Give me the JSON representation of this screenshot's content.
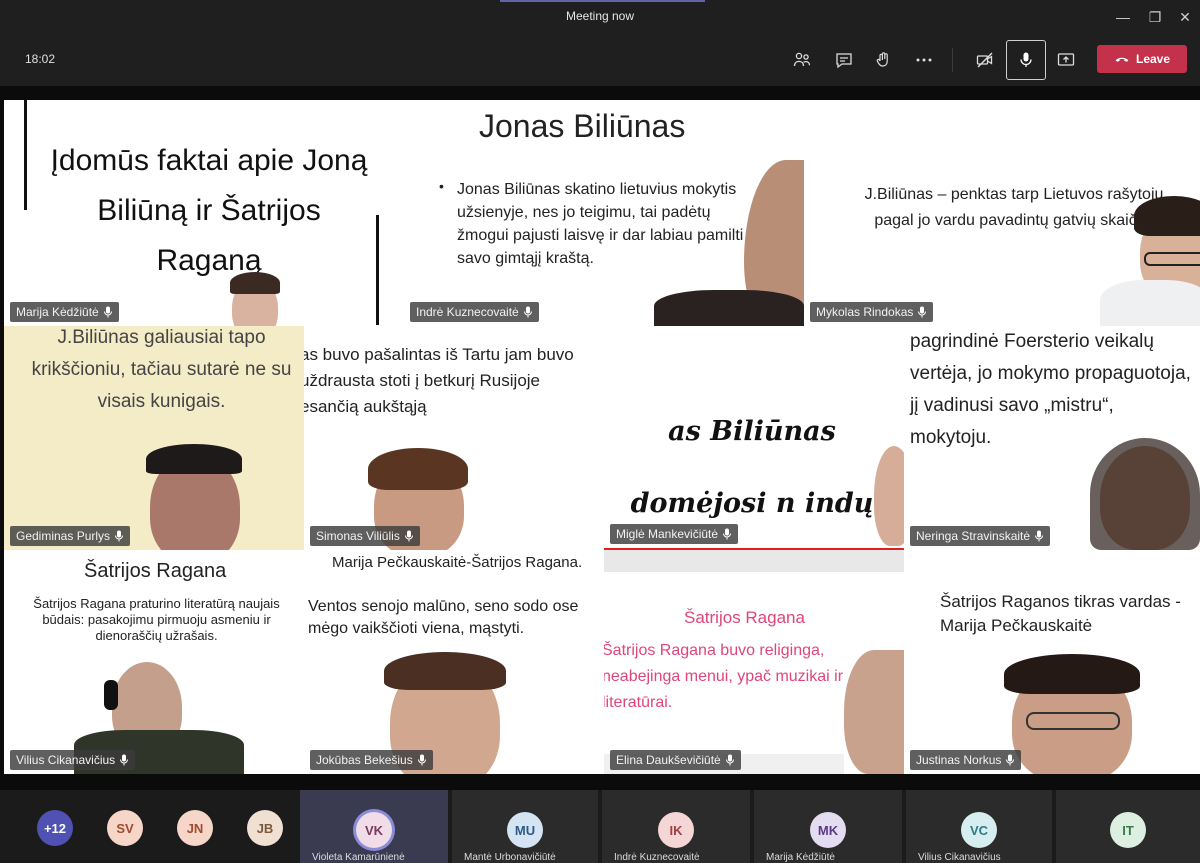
{
  "window": {
    "title": "Meeting now"
  },
  "toolbar": {
    "time": "18:02",
    "leave_label": "Leave"
  },
  "tiles": [
    {
      "name": "Marija Kėdžiūtė",
      "slide": "Įdomūs faktai apie Joną Biliūną ir Šatrijos Raganą"
    },
    {
      "name": "Indrė Kuznecovaitė",
      "slide_title": "Jonas Biliūnas",
      "slide": "Jonas Biliūnas skatino lietuvius mokytis užsienyje, nes jo teigimu, tai padėtų žmogui pajusti laisvę ir dar labiau pamilti savo gimtąjį kraštą."
    },
    {
      "name": "Mykolas Rindokas",
      "slide": "J.Biliūnas – penktas tarp Lietuvos rašytojų pagal jo vardu pavadintų gatvių skaičių."
    },
    {
      "name": "Gediminas Purlys",
      "slide": "J.Biliūnas galiausiai tapo krikščioniu, tačiau sutarė ne su visais kunigais."
    },
    {
      "name": "Simonas Viliūlis",
      "slide": "as buvo pašalintas iš Tartu jam buvo uždrausta stoti į betkurį Rusijoje esančią aukštąją"
    },
    {
      "name": "Miglė Mankevičiūtė",
      "slide": "as Biliūnas domėjosi n indų filosofija."
    },
    {
      "name": "Neringa Stravinskaitė",
      "slide": "pagrindinė Foersterio veikalų vertėja, jo mokymo propaguotoja, jį vadinusi savo „mistru“, mokytoju."
    },
    {
      "name": "Vilius Cikanavičius",
      "slide_title": "Šatrijos Ragana",
      "slide": "Šatrijos Ragana praturino literatūrą naujais būdais: pasakojimu pirmuoju asmeniu ir dienoraščių užrašais."
    },
    {
      "name": "Jokūbas Bekešius",
      "slide_title": "Marija Pečkauskaitė-Šatrijos Ragana.",
      "slide": "Ventos senojo malūno, seno sodo ose mėgo vaikščioti viena, mąstyti."
    },
    {
      "name": "Elina Daukševičiūtė",
      "slide_title": "Šatrijos Ragana",
      "slide": "Šatrijos Ragana buvo religinga, neabejinga menui, ypač muzikai ir literatūrai."
    },
    {
      "name": "Justinas Norkus",
      "slide": "Šatrijos Raganos tikras vardas - Marija Pečkauskaitė"
    }
  ],
  "tray": {
    "overflow": "+12",
    "avatars": [
      "SV",
      "JN",
      "JB"
    ],
    "people": [
      {
        "initials": "VK",
        "name": "Violeta Kamarūnienė"
      },
      {
        "initials": "MU",
        "name": "Mantė Urbonavičiūtė"
      },
      {
        "initials": "IK",
        "name": "Indrė Kuznecovaitė"
      },
      {
        "initials": "MK",
        "name": "Marija Kėdžiūtė"
      },
      {
        "initials": "VC",
        "name": "Vilius Cikanavičius"
      },
      {
        "initials": "IT",
        "name": ""
      }
    ]
  },
  "colors": {
    "accent": "#6264a7",
    "leave": "#c4314b"
  }
}
